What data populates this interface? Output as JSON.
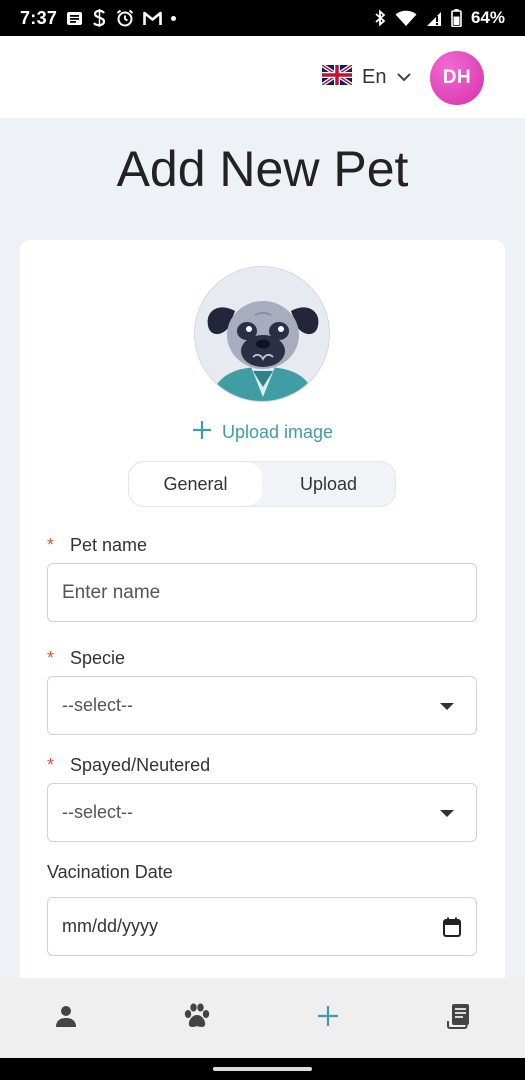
{
  "status_bar": {
    "time": "7:37",
    "battery": "64%",
    "left_icons": [
      "news-icon",
      "s-app-icon",
      "alarm-icon",
      "gmail-icon",
      "dot-icon"
    ],
    "right_icons": [
      "bluetooth-icon",
      "wifi-icon",
      "signal-icon",
      "battery-icon"
    ]
  },
  "header": {
    "language_code": "En",
    "avatar_initials": "DH",
    "avatar_color": "#d93bb0"
  },
  "page": {
    "title": "Add New Pet"
  },
  "form": {
    "upload_label": "Upload image",
    "tabs": [
      {
        "label": "General",
        "active": true
      },
      {
        "label": "Upload",
        "active": false
      }
    ],
    "pet_name": {
      "label": "Pet name",
      "required_mark": "*",
      "placeholder": "Enter name",
      "value": ""
    },
    "specie": {
      "label": "Specie",
      "required_mark": "*",
      "selected": "--select--"
    },
    "spayed": {
      "label": "Spayed/Neutered",
      "required_mark": "*",
      "selected": "--select--"
    },
    "vaccination": {
      "label": "Vacination Date",
      "placeholder": "mm/dd/yyyy"
    }
  },
  "bottom_nav": {
    "items": [
      {
        "icon": "person-icon"
      },
      {
        "icon": "paw-icon"
      },
      {
        "icon": "plus-icon"
      },
      {
        "icon": "records-icon"
      }
    ]
  },
  "colors": {
    "accent": "#3f9da3",
    "required": "#e5533d",
    "page_bg": "#eef1f6"
  }
}
